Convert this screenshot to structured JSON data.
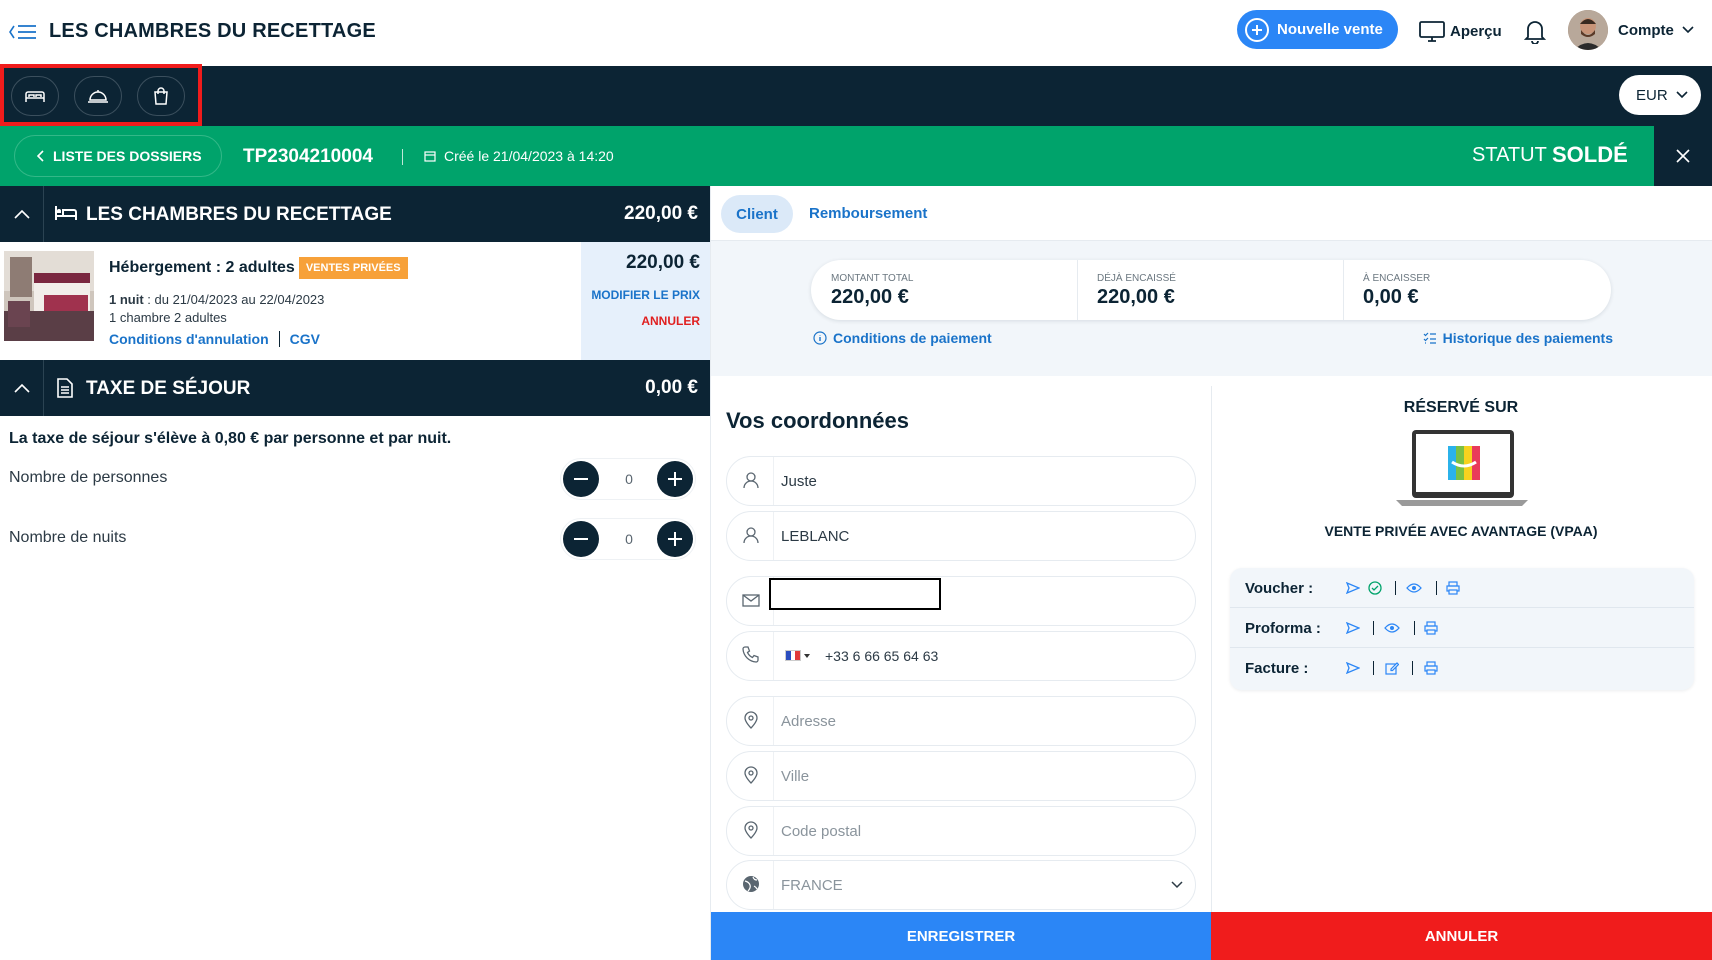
{
  "header": {
    "title": "LES CHAMBRES DU RECETTAGE",
    "new_sale_label": "Nouvelle vente",
    "preview_label": "Aperçu",
    "account_label": "Compte"
  },
  "toolbar": {
    "currency": "EUR"
  },
  "folder_bar": {
    "back_label": "LISTE DES DOSSIERS",
    "folder_id": "TP2304210004",
    "created": "Créé le 21/04/2023 à 14:20",
    "status_label": "STATUT",
    "status_value": "SOLDÉ"
  },
  "hotel_section": {
    "title": "LES CHAMBRES DU RECETTAGE",
    "total": "220,00 €",
    "item": {
      "title": "Hébergement : 2 adultes",
      "badge": "VENTES PRIVÉES",
      "nights_bold": "1 nuit",
      "dates": " : du 21/04/2023 au 22/04/2023",
      "rooms": "1 chambre 2 adultes",
      "cancel_conditions": "Conditions d'annulation",
      "cgv": "CGV",
      "price": "220,00 €",
      "modify_price": "MODIFIER LE PRIX",
      "cancel": "ANNULER"
    }
  },
  "tax_section": {
    "title": "TAXE DE SÉJOUR",
    "total": "0,00 €",
    "description": "La taxe de séjour s'élève à 0,80 € par personne et par nuit.",
    "persons_label": "Nombre de personnes",
    "persons_value": "0",
    "nights_label": "Nombre de nuits",
    "nights_value": "0"
  },
  "tabs": {
    "client": "Client",
    "refund": "Remboursement"
  },
  "payment": {
    "total_label": "MONTANT TOTAL",
    "total_value": "220,00 €",
    "collected_label": "DÉJÀ ENCAISSÉ",
    "collected_value": "220,00 €",
    "due_label": "À ENCAISSER",
    "due_value": "0,00 €",
    "conditions_link": "Conditions de paiement",
    "history_link": "Historique des paiements"
  },
  "contact": {
    "title": "Vos coordonnées",
    "first_name": "Juste",
    "last_name": "LEBLANC",
    "email": "",
    "phone": "+33 6 66 65 64 63",
    "address_placeholder": "Adresse",
    "city_placeholder": "Ville",
    "zip_placeholder": "Code postal",
    "country": "FRANCE"
  },
  "booking": {
    "reserved_on": "RÉSERVÉ SUR",
    "channel": "VENTE PRIVÉE AVEC AVANTAGE (VPAA)",
    "voucher_label": "Voucher :",
    "proforma_label": "Proforma :",
    "invoice_label": "Facture :"
  },
  "actions": {
    "save": "ENREGISTRER",
    "cancel": "ANNULER"
  },
  "colors": {
    "navy": "#0c2434",
    "green": "#00a36b",
    "blue": "#2b86f6",
    "red": "#f01c1c",
    "orange": "#f7a139",
    "link": "#1a73c9"
  }
}
